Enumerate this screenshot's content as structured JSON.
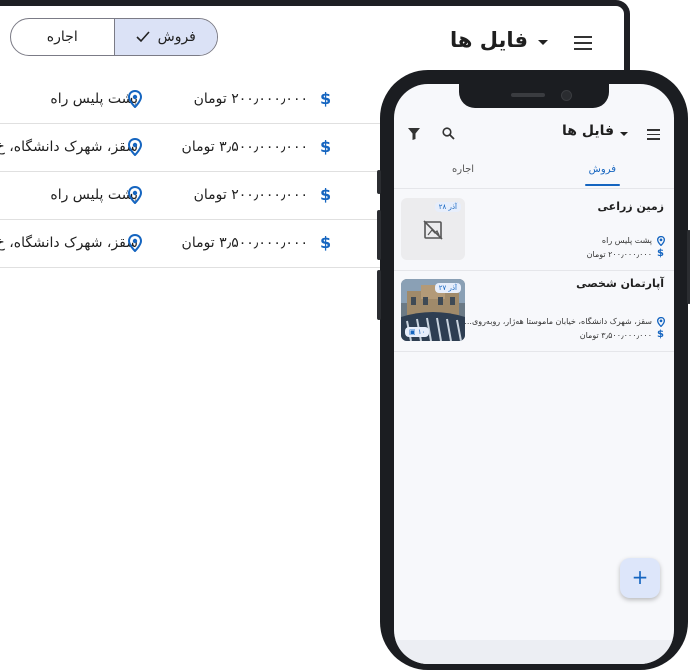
{
  "desktop": {
    "title": "فایل ها",
    "segment": {
      "rent_label": "اجاره",
      "sale_label": "فروش",
      "selected": "sale"
    },
    "rows": [
      {
        "price": "۲۰۰٫۰۰۰٫۰۰۰ تومان",
        "address": "پشت پلیس راه"
      },
      {
        "price": "۳٫۵۰۰٫۰۰۰٫۰۰۰ تومان",
        "address": "سقز، شهرک دانشگاه، خ"
      },
      {
        "price": "۲۰۰٫۰۰۰٫۰۰۰ تومان",
        "address": "پشت پلیس راه"
      },
      {
        "price": "۳٫۵۰۰٫۰۰۰٫۰۰۰ تومان",
        "address": "سقز، شهرک دانشگاه، خ"
      }
    ]
  },
  "phone": {
    "title": "فایل ها",
    "tabs": {
      "sale": "فروش",
      "rent": "اجاره",
      "active": "sale"
    },
    "cards": [
      {
        "title": "زمین زراعی",
        "address": "پشت پلیس راه",
        "price": "۲۰۰٫۰۰۰٫۰۰۰ تومان",
        "date": "۲۸ آذر",
        "has_image": false
      },
      {
        "title": "آپارتمان شخصی",
        "address": "سقز، شهرک دانشگاه، خیابان ماموستا هه‌ژار، روبه‌روی...",
        "price": "۳٫۵۰۰٫۰۰۰٫۰۰۰ تومان",
        "date": "۲۷ آذر",
        "image_count": "۱۰",
        "has_image": true
      }
    ],
    "fab_label": "+"
  },
  "colors": {
    "accent": "#1565c0",
    "selected_segment": "#dbe2f6",
    "phone_frame": "#1b1d21"
  }
}
